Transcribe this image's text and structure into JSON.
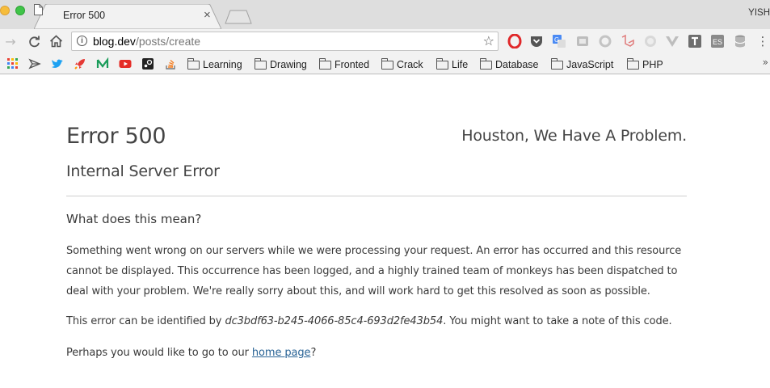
{
  "browser": {
    "tab_title": "Error 500",
    "tab_close": "×",
    "profile_name": "YISH",
    "url_host": "blog.dev",
    "url_path": "/posts/create",
    "nav": {
      "back_glyph": "→",
      "reload_glyph": "C",
      "home_glyph": "⌂",
      "star_glyph": "☆"
    },
    "extensions": [
      "opera-icon",
      "pocket-icon",
      "google-translate-icon",
      "image-icon",
      "sync-icon",
      "laravel-icon",
      "ad-icon",
      "vue-icon",
      "t-icon",
      "es-icon",
      "database-icon"
    ],
    "more_glyph": "⋮",
    "bookmarks": {
      "folders": [
        "Learning",
        "Drawing",
        "Fronted",
        "Crack",
        "Life",
        "Database",
        "JavaScript",
        "PHP"
      ],
      "overflow": "»"
    }
  },
  "page": {
    "error_code": "Error 500",
    "tagline": "Houston, We Have A Problem.",
    "error_name": "Internal Server Error",
    "meaning_heading": "What does this mean?",
    "explanation": "Something went wrong on our servers while we were processing your request. An error has occurred and this resource cannot be displayed. This occurrence has been logged, and a highly trained team of monkeys has been dispatched to deal with your problem. We're really sorry about this, and will work hard to get this resolved as soon as possible.",
    "identify_prefix": "This error can be identified by ",
    "error_id": "dc3bdf63-b245-4066-85c4-693d2fe43b54",
    "identify_suffix": ". You might want to take a note of this code.",
    "perhaps_prefix": "Perhaps you would like to go to our ",
    "home_link": "home page",
    "perhaps_suffix": "?"
  }
}
